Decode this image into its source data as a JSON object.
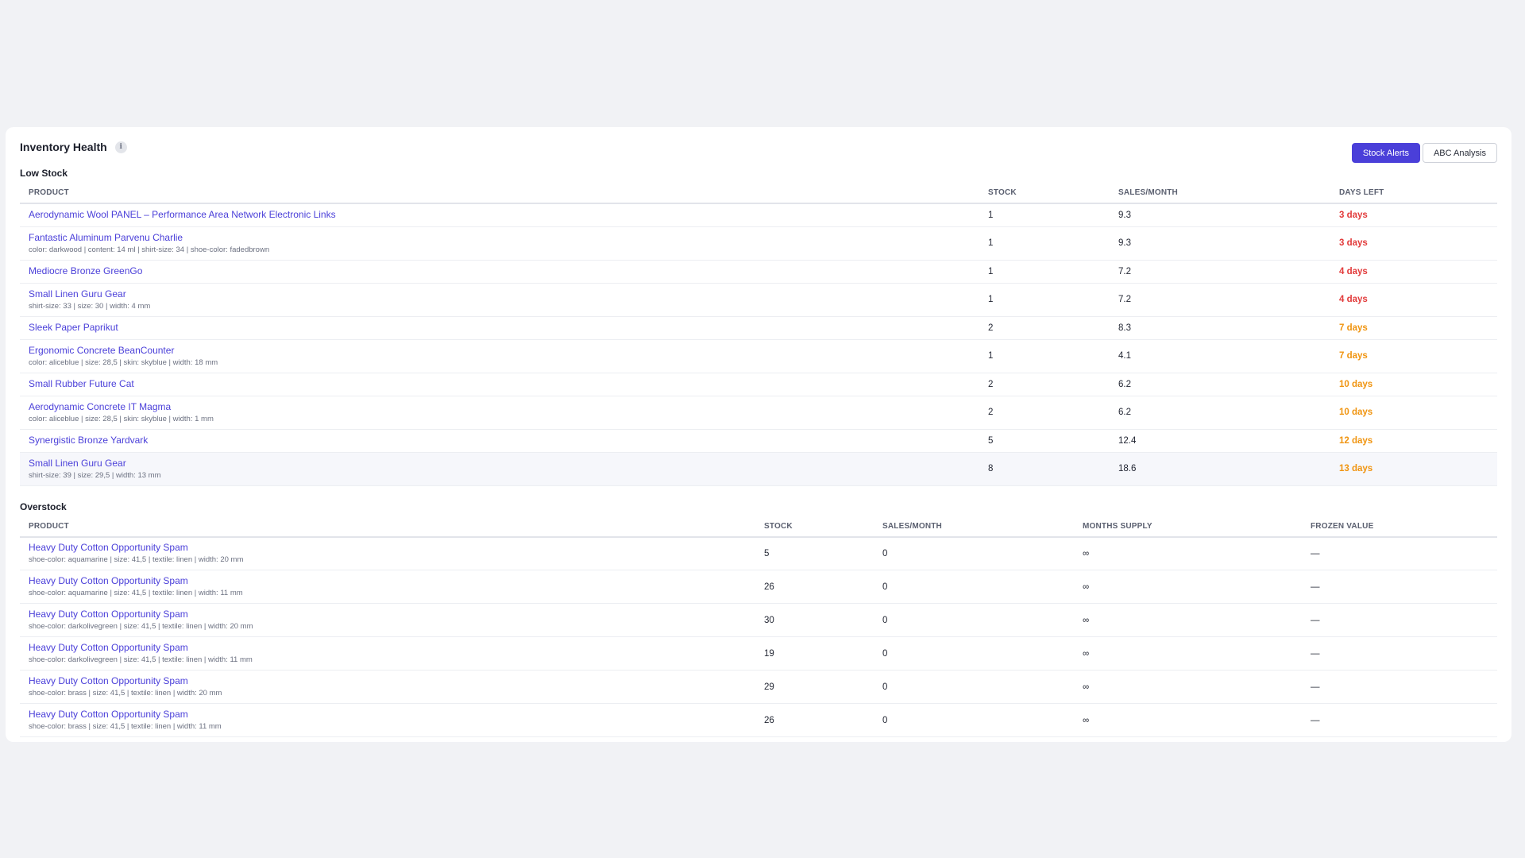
{
  "header": {
    "title": "Inventory Health",
    "info_glyph": "i",
    "tabs": [
      {
        "label": "Stock Alerts",
        "active": true
      },
      {
        "label": "ABC Analysis",
        "active": false
      }
    ]
  },
  "colors": {
    "accent": "#4a3fd9",
    "urgent": "#e23b3b",
    "warning": "#f0940f"
  },
  "low_stock": {
    "title": "Low Stock",
    "columns": [
      "Product",
      "Stock",
      "Sales/Month",
      "Days Left"
    ],
    "rows": [
      {
        "name": "Aerodynamic Wool PANEL – Performance Area Network Electronic Links",
        "meta": "",
        "stock": "1",
        "sales": "9.3",
        "days": "3 days",
        "level": "red"
      },
      {
        "name": "Fantastic Aluminum Parvenu Charlie",
        "meta": "color: darkwood | content: 14 ml | shirt-size: 34 | shoe-color: fadedbrown",
        "stock": "1",
        "sales": "9.3",
        "days": "3 days",
        "level": "red"
      },
      {
        "name": "Mediocre Bronze GreenGo",
        "meta": "",
        "stock": "1",
        "sales": "7.2",
        "days": "4 days",
        "level": "red"
      },
      {
        "name": "Small Linen Guru Gear",
        "meta": "shirt-size: 33 | size: 30 | width: 4 mm",
        "stock": "1",
        "sales": "7.2",
        "days": "4 days",
        "level": "red"
      },
      {
        "name": "Sleek Paper Paprikut",
        "meta": "",
        "stock": "2",
        "sales": "8.3",
        "days": "7 days",
        "level": "orange"
      },
      {
        "name": "Ergonomic Concrete BeanCounter",
        "meta": "color: aliceblue | size: 28,5 | skin: skyblue | width: 18 mm",
        "stock": "1",
        "sales": "4.1",
        "days": "7 days",
        "level": "orange"
      },
      {
        "name": "Small Rubber Future Cat",
        "meta": "",
        "stock": "2",
        "sales": "6.2",
        "days": "10 days",
        "level": "orange"
      },
      {
        "name": "Aerodynamic Concrete IT Magma",
        "meta": "color: aliceblue | size: 28,5 | skin: skyblue | width: 1 mm",
        "stock": "2",
        "sales": "6.2",
        "days": "10 days",
        "level": "orange"
      },
      {
        "name": "Synergistic Bronze Yardvark",
        "meta": "",
        "stock": "5",
        "sales": "12.4",
        "days": "12 days",
        "level": "orange"
      },
      {
        "name": "Small Linen Guru Gear",
        "meta": "shirt-size: 39 | size: 29,5 | width: 13 mm",
        "stock": "8",
        "sales": "18.6",
        "days": "13 days",
        "level": "orange",
        "highlight": true
      }
    ]
  },
  "overstock": {
    "title": "Overstock",
    "columns": [
      "Product",
      "Stock",
      "Sales/Month",
      "Months Supply",
      "Frozen Value"
    ],
    "rows": [
      {
        "name": "Heavy Duty Cotton Opportunity Spam",
        "meta": "shoe-color: aquamarine | size: 41,5 | textile: linen | width: 20 mm",
        "stock": "5",
        "sales": "0",
        "supply": "∞",
        "frozen": "—"
      },
      {
        "name": "Heavy Duty Cotton Opportunity Spam",
        "meta": "shoe-color: aquamarine | size: 41,5 | textile: linen | width: 11 mm",
        "stock": "26",
        "sales": "0",
        "supply": "∞",
        "frozen": "—"
      },
      {
        "name": "Heavy Duty Cotton Opportunity Spam",
        "meta": "shoe-color: darkolivegreen | size: 41,5 | textile: linen | width: 20 mm",
        "stock": "30",
        "sales": "0",
        "supply": "∞",
        "frozen": "—"
      },
      {
        "name": "Heavy Duty Cotton Opportunity Spam",
        "meta": "shoe-color: darkolivegreen | size: 41,5 | textile: linen | width: 11 mm",
        "stock": "19",
        "sales": "0",
        "supply": "∞",
        "frozen": "—"
      },
      {
        "name": "Heavy Duty Cotton Opportunity Spam",
        "meta": "shoe-color: brass | size: 41,5 | textile: linen | width: 20 mm",
        "stock": "29",
        "sales": "0",
        "supply": "∞",
        "frozen": "—"
      },
      {
        "name": "Heavy Duty Cotton Opportunity Spam",
        "meta": "shoe-color: brass | size: 41,5 | textile: linen | width: 11 mm",
        "stock": "26",
        "sales": "0",
        "supply": "∞",
        "frozen": "—"
      }
    ]
  }
}
